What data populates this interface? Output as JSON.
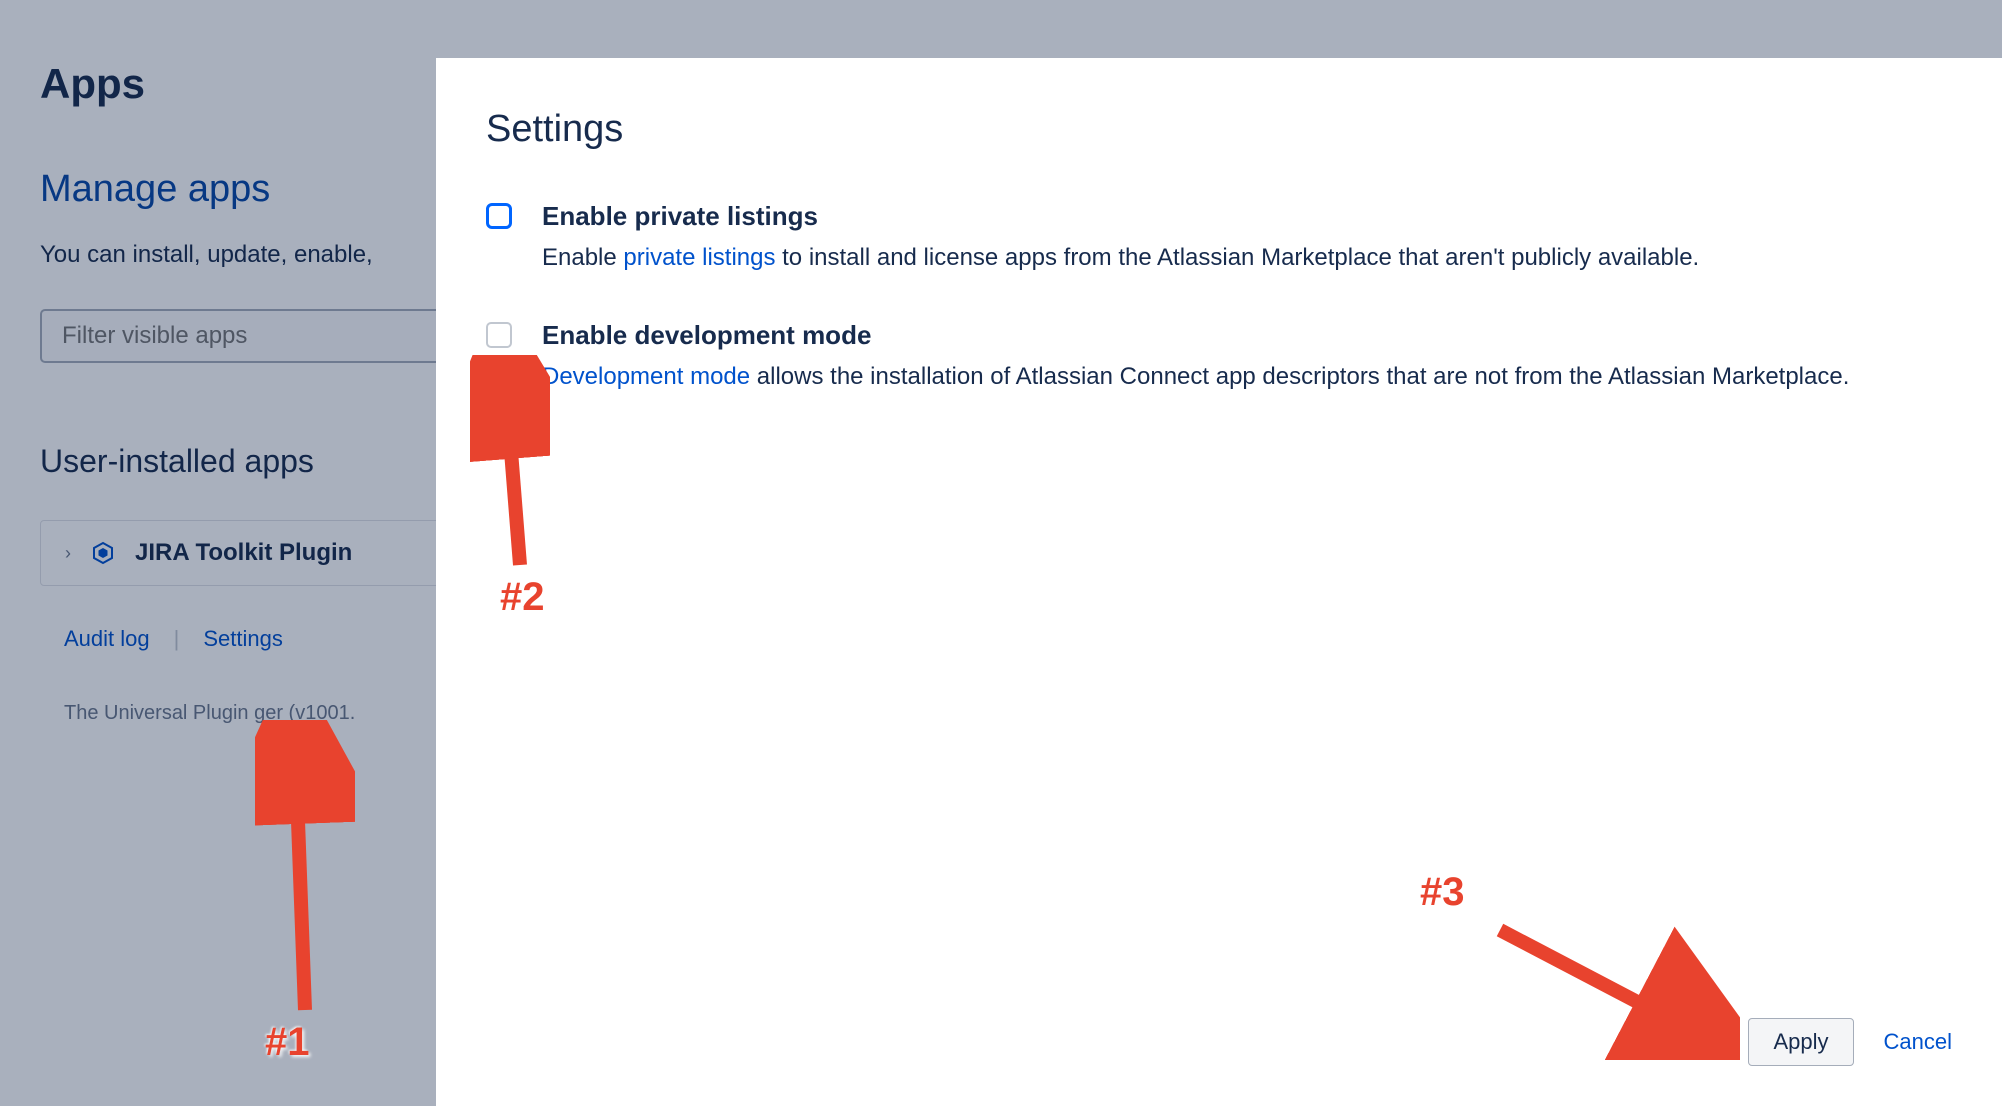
{
  "page": {
    "apps_heading": "Apps",
    "manage_heading": "Manage apps",
    "description": "You can install, update, enable,",
    "filter_placeholder": "Filter visible apps",
    "section_heading": "User-installed apps",
    "plugin_name": "JIRA Toolkit Plugin",
    "links": {
      "audit_log": "Audit log",
      "settings": "Settings"
    },
    "version_text": "The Universal Plugin          ger (v1001."
  },
  "modal": {
    "title": "Settings",
    "options": [
      {
        "label": "Enable private listings",
        "desc_prefix": "Enable ",
        "desc_link": "private listings",
        "desc_suffix": " to install and license apps from the Atlassian Marketplace that aren't publicly available."
      },
      {
        "label": "Enable development mode",
        "desc_prefix": "",
        "desc_link": "Development mode",
        "desc_suffix": " allows the installation of Atlassian Connect app descriptors that are not from the Atlassian Marketplace."
      }
    ],
    "apply": "Apply",
    "cancel": "Cancel"
  },
  "annotations": {
    "step1": "#1",
    "step2": "#2",
    "step3": "#3"
  }
}
